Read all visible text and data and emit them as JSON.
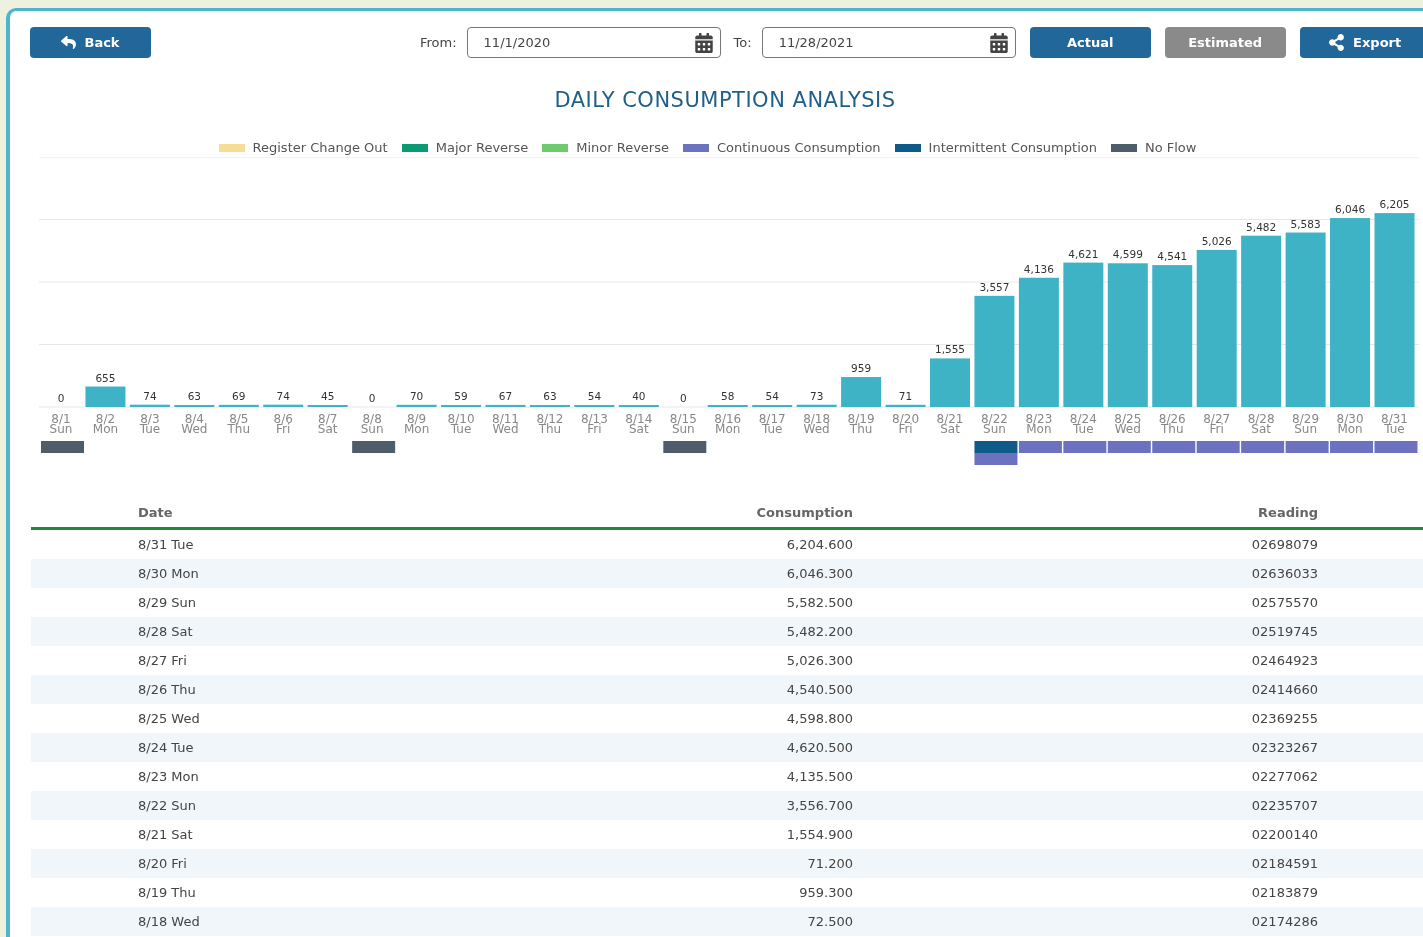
{
  "back_button": {
    "label": "Back"
  },
  "date_range": {
    "from_label": "From:",
    "from_value": "11/1/2020",
    "to_label": "To:",
    "to_value": "11/28/2021"
  },
  "view_buttons": [
    {
      "label": "Actual",
      "selected": true
    },
    {
      "label": "Estimated",
      "selected": false
    }
  ],
  "export_button": {
    "label": "Export"
  },
  "title": "DAILY CONSUMPTION ANALYSIS",
  "legend": [
    {
      "label": "Register Change Out",
      "color": "#f7dc95"
    },
    {
      "label": "Major Reverse",
      "color": "#0a9a74"
    },
    {
      "label": "Minor Reverse",
      "color": "#6ccb6c"
    },
    {
      "label": "Continuous Consumption",
      "color": "#6c72c0"
    },
    {
      "label": "Intermittent Consumption",
      "color": "#0e5a88"
    },
    {
      "label": "No Flow",
      "color": "#4f5d6a"
    }
  ],
  "chart_data": {
    "type": "bar",
    "ylim": [
      0,
      8000
    ],
    "categories": [
      "8/1 Sun",
      "8/2 Mon",
      "8/3 Tue",
      "8/4 Wed",
      "8/5 Thu",
      "8/6 Fri",
      "8/7 Sat",
      "8/8 Sun",
      "8/9 Mon",
      "8/10 Tue",
      "8/11 Wed",
      "8/12 Thu",
      "8/13 Fri",
      "8/14 Sat",
      "8/15 Sun",
      "8/16 Mon",
      "8/17 Tue",
      "8/18 Wed",
      "8/19 Thu",
      "8/20 Fri",
      "8/21 Sat",
      "8/22 Sun",
      "8/23 Mon",
      "8/24 Tue",
      "8/25 Wed",
      "8/26 Thu",
      "8/27 Fri",
      "8/28 Sat",
      "8/29 Sun",
      "8/30 Mon",
      "8/31 Tue"
    ],
    "values": [
      0,
      655,
      74,
      63,
      69,
      74,
      45,
      0,
      70,
      59,
      67,
      63,
      54,
      40,
      0,
      58,
      54,
      73,
      959,
      71,
      1555,
      3557,
      4136,
      4621,
      4599,
      4541,
      5026,
      5482,
      5583,
      6046,
      6205
    ],
    "value_labels": [
      "0",
      "655",
      "74",
      "63",
      "69",
      "74",
      "45",
      "0",
      "70",
      "59",
      "67",
      "63",
      "54",
      "40",
      "0",
      "58",
      "54",
      "73",
      "959",
      "71",
      "1,555",
      "3,557",
      "4,136",
      "4,621",
      "4,599",
      "4,541",
      "5,026",
      "5,482",
      "5,583",
      "6,046",
      "6,205"
    ]
  },
  "event_markers": [
    {
      "kind": "no_flow"
    },
    {
      "kind": "none"
    },
    {
      "kind": "none"
    },
    {
      "kind": "none"
    },
    {
      "kind": "none"
    },
    {
      "kind": "none"
    },
    {
      "kind": "none"
    },
    {
      "kind": "no_flow"
    },
    {
      "kind": "none"
    },
    {
      "kind": "none"
    },
    {
      "kind": "none"
    },
    {
      "kind": "none"
    },
    {
      "kind": "none"
    },
    {
      "kind": "none"
    },
    {
      "kind": "no_flow"
    },
    {
      "kind": "none"
    },
    {
      "kind": "none"
    },
    {
      "kind": "none"
    },
    {
      "kind": "none"
    },
    {
      "kind": "none"
    },
    {
      "kind": "none"
    },
    {
      "kind": "intermittent_continuous"
    },
    {
      "kind": "continuous"
    },
    {
      "kind": "continuous"
    },
    {
      "kind": "continuous"
    },
    {
      "kind": "continuous"
    },
    {
      "kind": "continuous"
    },
    {
      "kind": "continuous"
    },
    {
      "kind": "continuous"
    },
    {
      "kind": "continuous"
    },
    {
      "kind": "continuous"
    }
  ],
  "table": {
    "columns": [
      "Date",
      "Consumption",
      "Reading"
    ],
    "rows": [
      [
        "8/31 Tue",
        "6,204.600",
        "02698079"
      ],
      [
        "8/30 Mon",
        "6,046.300",
        "02636033"
      ],
      [
        "8/29 Sun",
        "5,582.500",
        "02575570"
      ],
      [
        "8/28 Sat",
        "5,482.200",
        "02519745"
      ],
      [
        "8/27 Fri",
        "5,026.300",
        "02464923"
      ],
      [
        "8/26 Thu",
        "4,540.500",
        "02414660"
      ],
      [
        "8/25 Wed",
        "4,598.800",
        "02369255"
      ],
      [
        "8/24 Tue",
        "4,620.500",
        "02323267"
      ],
      [
        "8/23 Mon",
        "4,135.500",
        "02277062"
      ],
      [
        "8/22 Sun",
        "3,556.700",
        "02235707"
      ],
      [
        "8/21 Sat",
        "1,554.900",
        "02200140"
      ],
      [
        "8/20 Fri",
        "71.200",
        "02184591"
      ],
      [
        "8/19 Thu",
        "959.300",
        "02183879"
      ],
      [
        "8/18 Wed",
        "72.500",
        "02174286"
      ]
    ]
  }
}
